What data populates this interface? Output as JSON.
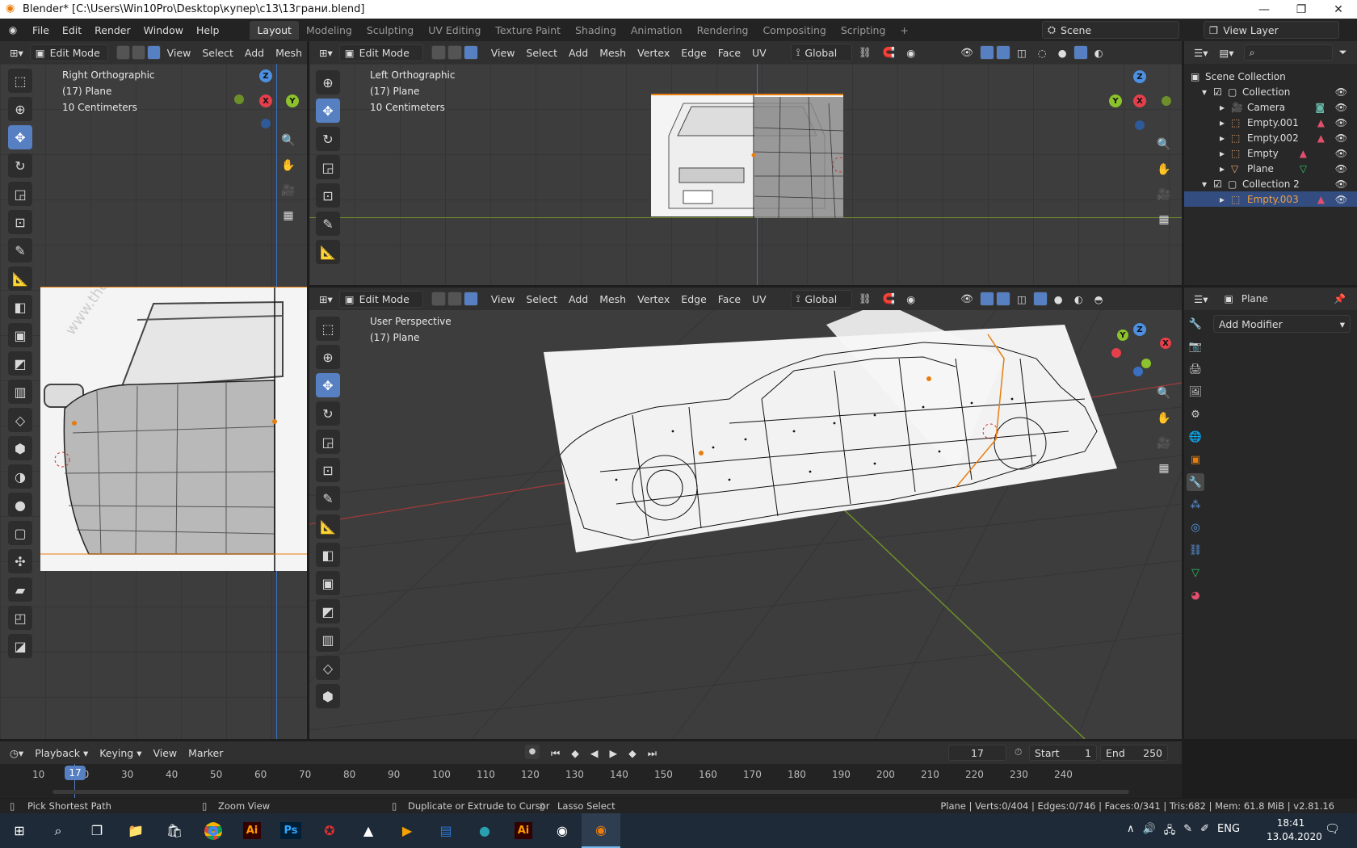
{
  "window": {
    "title": "Blender* [C:\\Users\\Win10Pro\\Desktop\\купер\\с13\\13грани.blend]"
  },
  "topbar": {
    "menus": [
      "File",
      "Edit",
      "Render",
      "Window",
      "Help"
    ],
    "workspaces": [
      "Layout",
      "Modeling",
      "Sculpting",
      "UV Editing",
      "Texture Paint",
      "Shading",
      "Animation",
      "Rendering",
      "Compositing",
      "Scripting"
    ],
    "active_workspace": "Layout",
    "scene": "Scene",
    "view_layer": "View Layer",
    "add_tab": "+"
  },
  "viewport_left": {
    "mode": "Edit Mode",
    "menus": [
      "View",
      "Select",
      "Add",
      "Mesh"
    ],
    "overlay": [
      "Right Orthographic",
      "(17) Plane",
      "10 Centimeters"
    ],
    "axes": {
      "z": "Z",
      "x": "X",
      "y": "Y"
    }
  },
  "viewport_top": {
    "mode": "Edit Mode",
    "menus": [
      "View",
      "Select",
      "Add",
      "Mesh",
      "Vertex",
      "Edge",
      "Face",
      "UV"
    ],
    "transform": "Global",
    "overlay": [
      "Left Orthographic",
      "(17) Plane",
      "10 Centimeters"
    ],
    "axes": {
      "z": "Z",
      "x": "X",
      "y": "Y"
    }
  },
  "viewport_main": {
    "mode": "Edit Mode",
    "menus": [
      "View",
      "Select",
      "Add",
      "Mesh",
      "Vertex",
      "Edge",
      "Face",
      "UV"
    ],
    "transform": "Global",
    "overlay": [
      "User Perspective",
      "(17) Plane"
    ],
    "axes": {
      "z": "Z",
      "x": "X",
      "y": "Y"
    }
  },
  "outliner": {
    "root": "Scene Collection",
    "items": [
      {
        "name": "Collection",
        "level": 1,
        "kind": "collection"
      },
      {
        "name": "Camera",
        "level": 2,
        "kind": "camera"
      },
      {
        "name": "Empty.001",
        "level": 2,
        "kind": "empty"
      },
      {
        "name": "Empty.002",
        "level": 2,
        "kind": "empty"
      },
      {
        "name": "Empty",
        "level": 2,
        "kind": "empty"
      },
      {
        "name": "Plane",
        "level": 2,
        "kind": "mesh"
      },
      {
        "name": "Collection 2",
        "level": 1,
        "kind": "collection"
      },
      {
        "name": "Empty.003",
        "level": 2,
        "kind": "empty",
        "selected": true
      }
    ]
  },
  "properties": {
    "object": "Plane",
    "add_modifier": "Add Modifier"
  },
  "timeline": {
    "menus": [
      "Playback",
      "Keying",
      "View",
      "Marker"
    ],
    "current_frame": "17",
    "start_label": "Start",
    "start": "1",
    "end_label": "End",
    "end": "250",
    "ticks": [
      "10",
      "20",
      "30",
      "40",
      "50",
      "60",
      "70",
      "80",
      "90",
      "100",
      "110",
      "120",
      "130",
      "140",
      "150",
      "160",
      "170",
      "180",
      "190",
      "200",
      "210",
      "220",
      "230",
      "240"
    ]
  },
  "statusbar": {
    "hints": [
      "Pick Shortest Path",
      "Zoom View",
      "Duplicate or Extrude to Cursor",
      "Lasso Select"
    ],
    "stats": "Plane | Verts:0/404 | Edges:0/746 | Faces:0/341 | Tris:682 | Mem: 61.8 MiB | v2.81.16"
  },
  "taskbar": {
    "lang": "ENG",
    "time": "18:41",
    "date": "13.04.2020"
  },
  "colors": {
    "accent": "#5680c2",
    "x_axis": "#e4404b",
    "y_axis": "#8cc22b",
    "z_axis": "#4d8fe0",
    "selected_text": "#f0a040"
  }
}
